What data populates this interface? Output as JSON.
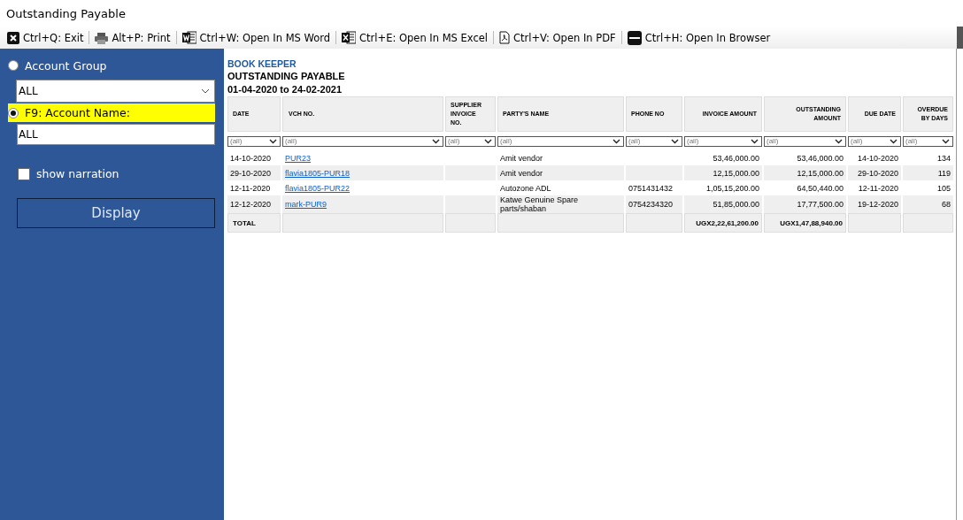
{
  "window": {
    "title": "Outstanding Payable"
  },
  "toolbar": [
    {
      "kind": "exit",
      "label": "Ctrl+Q: Exit"
    },
    {
      "kind": "print",
      "label": "Alt+P: Print"
    },
    {
      "kind": "word",
      "label": "Ctrl+W: Open In MS Word"
    },
    {
      "kind": "excel",
      "label": "Ctrl+E: Open In MS Excel"
    },
    {
      "kind": "pdf",
      "label": "Ctrl+V: Open In PDF"
    },
    {
      "kind": "html",
      "label": "Ctrl+H: Open In Browser"
    }
  ],
  "sidebar": {
    "account_group": {
      "label": "Account Group",
      "selected": false,
      "value": "ALL"
    },
    "account_name": {
      "label": "F9: Account Name:",
      "selected": true,
      "value": "ALL"
    },
    "show_narration": {
      "label": "show narration",
      "checked": false
    },
    "display_button": "Display"
  },
  "report": {
    "company": "BOOK KEEPER",
    "title": "OUTSTANDING PAYABLE",
    "period": "01-04-2020 to 24-02-2021"
  },
  "table": {
    "columns": [
      {
        "label": "DATE",
        "kind": "text",
        "filter": "(all)"
      },
      {
        "label": "VCH NO.",
        "kind": "link",
        "filter": "(all)"
      },
      {
        "label": "SUPPLIER INVOICE NO.",
        "kind": "text",
        "filter": "(all)"
      },
      {
        "label": "PARTY'S NAME",
        "kind": "text",
        "filter": "(all)"
      },
      {
        "label": "PHONE NO",
        "kind": "text",
        "filter": "(all)"
      },
      {
        "label": "INVOICE AMOUNT",
        "kind": "number",
        "filter": "(all)"
      },
      {
        "label": "OUTSTANDING AMOUNT",
        "kind": "number",
        "filter": "(all)"
      },
      {
        "label": "DUE DATE",
        "kind": "number",
        "filter": "(all)"
      },
      {
        "label": "OVERDUE BY DAYS",
        "kind": "number",
        "filter": "(all)"
      }
    ],
    "rows": [
      [
        "14-10-2020",
        "PUR23",
        "",
        "Amit vendor",
        "",
        "53,46,000.00",
        "53,46,000.00",
        "14-10-2020",
        "134"
      ],
      [
        "29-10-2020",
        "flavia1805-PUR18",
        "",
        "Amit vendor",
        "",
        "12,15,000.00",
        "12,15,000.00",
        "29-10-2020",
        "119"
      ],
      [
        "12-11-2020",
        "flavia1805-PUR22",
        "",
        "Autozone ADL",
        "0751431432",
        "1,05,15,200.00",
        "64,50,440.00",
        "12-11-2020",
        "105"
      ],
      [
        "12-12-2020",
        "mark-PUR9",
        "",
        "Katwe Genuine Spare parts/shaban",
        "0754234320",
        "51,85,000.00",
        "17,77,500.00",
        "19-12-2020",
        "68"
      ]
    ],
    "total": {
      "label": "TOTAL",
      "invoice_amount": "UGX2,22,61,200.00",
      "outstanding_amount": "UGX1,47,88,940.00"
    }
  }
}
